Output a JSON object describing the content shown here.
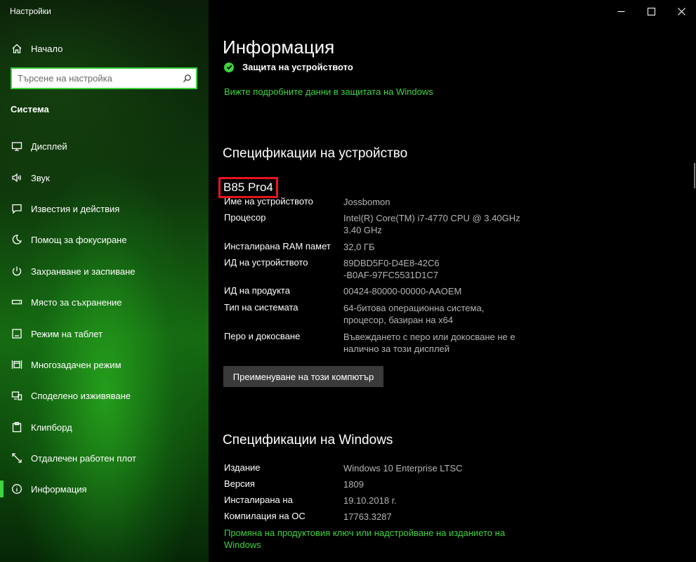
{
  "window": {
    "title": "Настройки"
  },
  "sidebar": {
    "home": {
      "label": "Начало",
      "icon": "home-icon"
    },
    "search": {
      "placeholder": "Търсене на настройка",
      "value": ""
    },
    "section_heading": "Система",
    "items": [
      {
        "label": "Дисплей",
        "icon": "display-icon"
      },
      {
        "label": "Звук",
        "icon": "sound-icon"
      },
      {
        "label": "Известия и действия",
        "icon": "notifications-icon"
      },
      {
        "label": "Помощ за фокусиране",
        "icon": "focus-moon-icon"
      },
      {
        "label": "Захранване и заспиване",
        "icon": "power-icon"
      },
      {
        "label": "Място за съхранение",
        "icon": "storage-icon"
      },
      {
        "label": "Режим на таблет",
        "icon": "tablet-icon"
      },
      {
        "label": "Многозадачен режим",
        "icon": "multitasking-icon"
      },
      {
        "label": "Споделено изживяване",
        "icon": "shared-experience-icon"
      },
      {
        "label": "Клипборд",
        "icon": "clipboard-icon"
      },
      {
        "label": "Отдалечен работен плот",
        "icon": "remote-desktop-icon"
      },
      {
        "label": "Информация",
        "icon": "info-icon",
        "active": true
      }
    ]
  },
  "main": {
    "title": "Информация",
    "protection": {
      "label": "Защита на устройството",
      "link": "Вижте подробните данни в защитата на Windows"
    },
    "device_specs": {
      "heading": "Спецификации на устройство",
      "device_name": "B85 Pro4",
      "rows": [
        {
          "key": "Име на устройството",
          "value": "Jossbomon"
        },
        {
          "key": "Процесор",
          "value": "Intel(R) Core(TM) i7-4770 CPU @ 3.40GHz 3.40 GHz"
        },
        {
          "key": "Инсталирана RAM памет",
          "value": "32,0 ГБ"
        },
        {
          "key": "ИД на устройството",
          "value": "89DBD5F0-D4E8-42C6-B0AF-97FC5531D1C7"
        },
        {
          "key": "ИД на продукта",
          "value": "00424-80000-00000-AAOEM"
        },
        {
          "key": "Тип на системата",
          "value": "64-битова операционна система, процесор, базиран на x64"
        },
        {
          "key": "Перо и докосване",
          "value": "Въвеждането с перо или докосване не е налично за този дисплей"
        }
      ],
      "rename_button": "Преименуване на този компютър"
    },
    "windows_specs": {
      "heading": "Спецификации на Windows",
      "rows": [
        {
          "key": "Издание",
          "value": "Windows 10 Enterprise LTSC"
        },
        {
          "key": "Версия",
          "value": "1809"
        },
        {
          "key": "Инсталирана на",
          "value": "19.10.2018 г."
        },
        {
          "key": "Компилация на ОС",
          "value": "17763.3287"
        }
      ],
      "key_link": "Промяна на продуктовия ключ или надстройване на изданието на Windows"
    }
  },
  "colors": {
    "accent": "#3fd33f",
    "highlight_box": "#e8141b",
    "value_text": "#b4b4b4"
  }
}
